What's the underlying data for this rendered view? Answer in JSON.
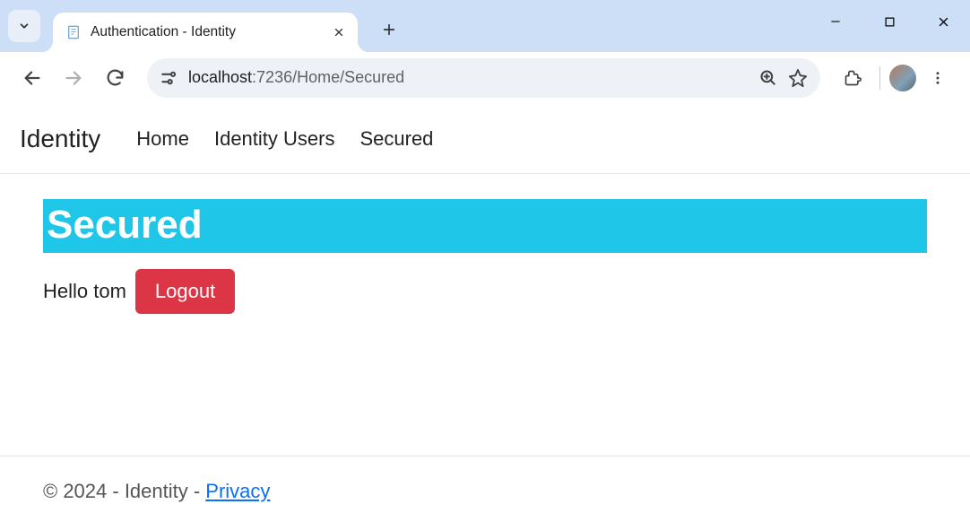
{
  "browser": {
    "tab_title": "Authentication - Identity",
    "url_host": "localhost",
    "url_path": ":7236/Home/Secured"
  },
  "navbar": {
    "brand": "Identity",
    "links": [
      "Home",
      "Identity Users",
      "Secured"
    ]
  },
  "page": {
    "heading": "Secured",
    "greeting": "Hello tom",
    "logout_label": "Logout"
  },
  "footer": {
    "text_prefix": "© 2024 - Identity - ",
    "privacy_label": "Privacy"
  }
}
